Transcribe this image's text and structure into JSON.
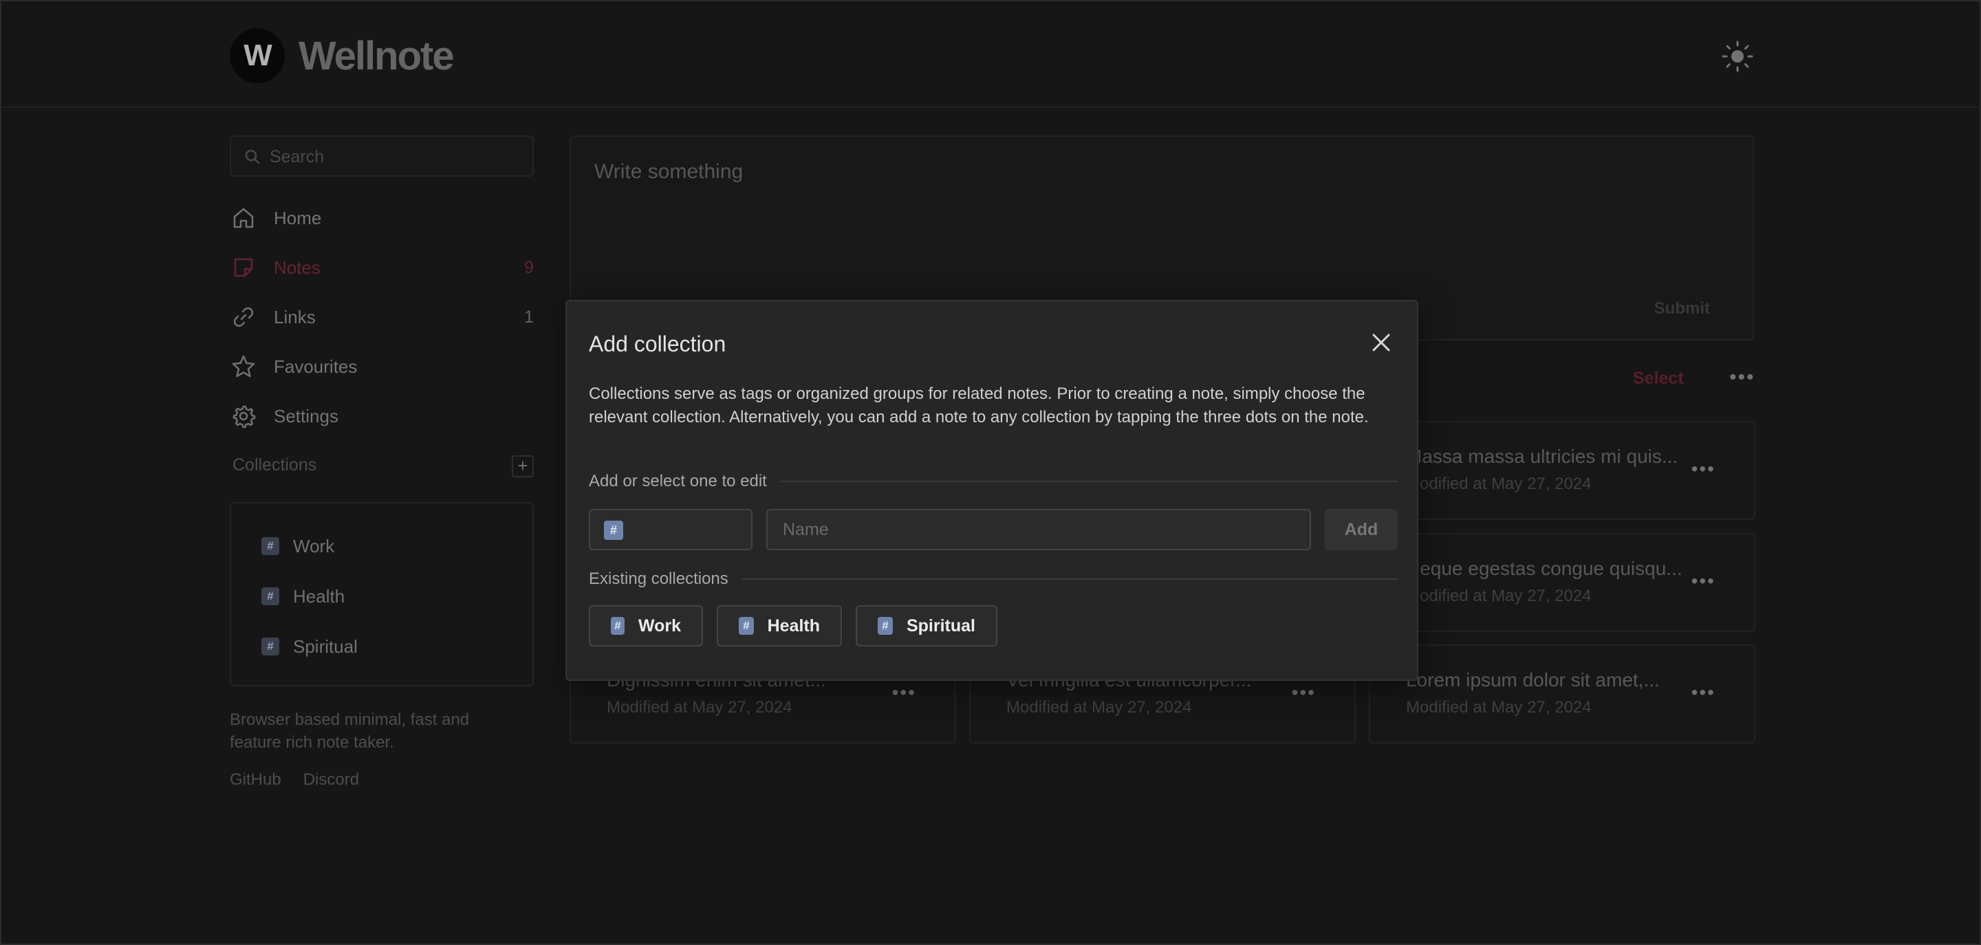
{
  "app": {
    "logo_letter": "W",
    "name": "Wellnote"
  },
  "sidebar": {
    "search_placeholder": "Search",
    "nav": [
      {
        "label": "Home",
        "count": ""
      },
      {
        "label": "Notes",
        "count": "9"
      },
      {
        "label": "Links",
        "count": "1"
      },
      {
        "label": "Favourites",
        "count": ""
      },
      {
        "label": "Settings",
        "count": ""
      }
    ],
    "collections_title": "Collections",
    "collections_add": "+",
    "collections": [
      {
        "label": "Work"
      },
      {
        "label": "Health"
      },
      {
        "label": "Spiritual"
      }
    ],
    "footer_text": "Browser based minimal, fast and feature rich note taker.",
    "footer_links": [
      "GitHub",
      "Discord"
    ]
  },
  "editor": {
    "placeholder": "Write something",
    "submit_label": "Submit"
  },
  "toolbar": {
    "select_label": "Select",
    "more_label": "•••"
  },
  "notes": [
    {
      "title": "Massa massa ultricies mi quis...",
      "date": "Modified at May 27, 2024"
    },
    {
      "title": "Neque egestas congue quisqu...",
      "date": "Modified at May 27, 2024"
    },
    {
      "title": "Dignissim enim sit amet...",
      "date": "Modified at May 27, 2024"
    },
    {
      "title": "Vel fringilla est ullamcorper...",
      "date": "Modified at May 27, 2024"
    },
    {
      "title": "Lorem ipsum dolor sit amet,...",
      "date": "Modified at May 27, 2024"
    }
  ],
  "modal": {
    "title": "Add collection",
    "description": "Collections serve as tags or organized groups for related notes. Prior to creating a note, simply choose the relevant collection. Alternatively, you can add a note to any collection by tapping the three dots on the note.",
    "add_section_label": "Add or select one to edit",
    "icon_symbol": "#",
    "name_placeholder": "Name",
    "add_button": "Add",
    "existing_section_label": "Existing collections",
    "existing": [
      {
        "label": "Work"
      },
      {
        "label": "Health"
      },
      {
        "label": "Spiritual"
      }
    ]
  },
  "colors": {
    "accent": "#7d2b3e",
    "background": "#1b1b1b",
    "modal_bg": "#262626",
    "badge": "#6f84ad"
  }
}
